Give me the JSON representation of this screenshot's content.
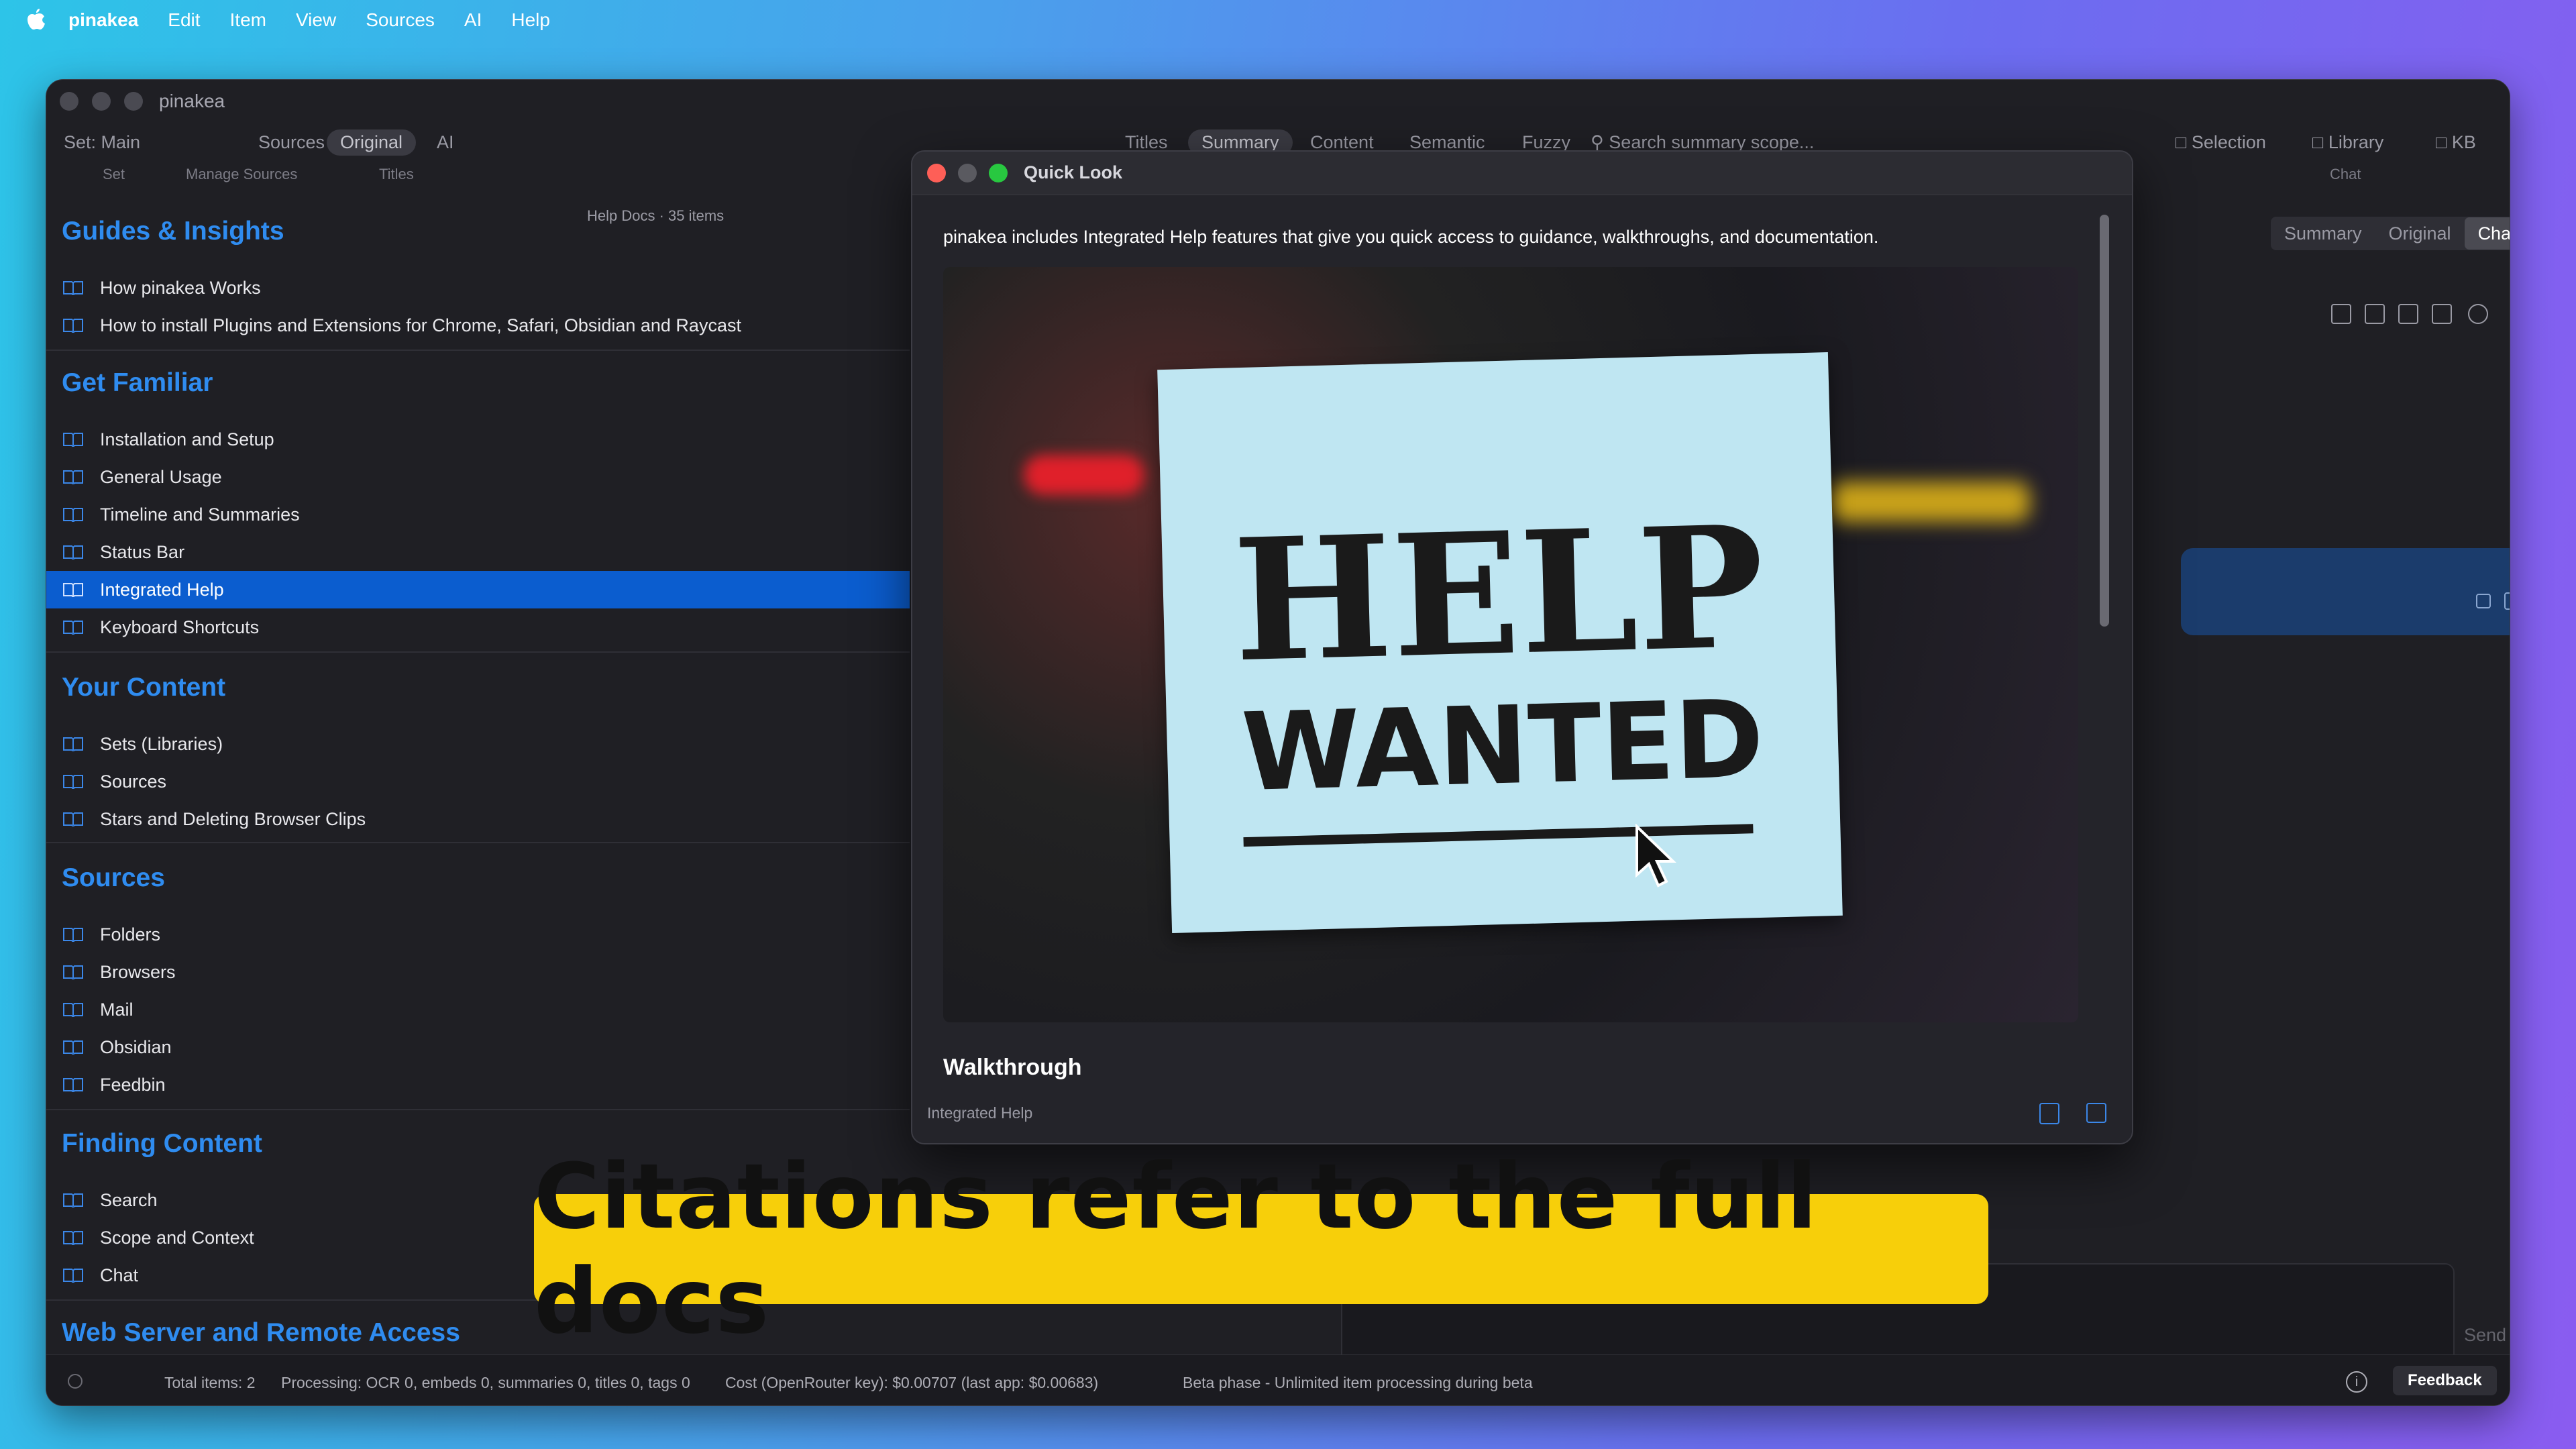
{
  "menubar": {
    "app": "pinakea",
    "items": [
      "Edit",
      "Item",
      "View",
      "Sources",
      "AI",
      "Help"
    ]
  },
  "window": {
    "title": "pinakea"
  },
  "toolbar": {
    "set": "Set: Main",
    "set_sub": "Set",
    "sources": "Sources",
    "sources_sub": "Manage Sources",
    "original": "Original",
    "ai": "AI",
    "titles_sub": "Titles",
    "tabs": [
      "Titles",
      "Summary",
      "Content",
      "Semantic",
      "Fuzzy"
    ],
    "search_placeholder": "Search summary scope...",
    "selection": "Selection",
    "library": "Library",
    "kb": "KB",
    "chat_sub": "Chat"
  },
  "sidebar": {
    "helpdocs": "Help Docs · 35 items",
    "sections": [
      {
        "title": "Guides & Insights",
        "items": [
          "How pinakea Works",
          "How to install Plugins and Extensions for Chrome, Safari, Obsidian and Raycast"
        ]
      },
      {
        "title": "Get Familiar",
        "items": [
          "Installation and Setup",
          "General Usage",
          "Timeline and Summaries",
          "Status Bar",
          "Integrated Help",
          "Keyboard Shortcuts"
        ]
      },
      {
        "title": "Your Content",
        "items": [
          "Sets (Libraries)",
          "Sources",
          "Stars and Deleting Browser Clips"
        ]
      },
      {
        "title": "Sources",
        "items": [
          "Folders",
          "Browsers",
          "Mail",
          "Obsidian",
          "Feedbin"
        ]
      },
      {
        "title": "Finding Content",
        "items": [
          "Search",
          "Scope and Context",
          "Chat"
        ]
      },
      {
        "title": "Web Server and Remote Access",
        "items": []
      }
    ],
    "selected": "Integrated Help"
  },
  "right": {
    "segments": [
      "Summary",
      "Original",
      "Chat"
    ],
    "active": "Chat"
  },
  "quicklook": {
    "title": "Quick Look",
    "intro": "pinakea includes Integrated Help features that give you quick access to guidance, walkthroughs, and documentation.",
    "image_line1": "HELP",
    "image_line2": "WANTED",
    "heading": "Walkthrough",
    "footer": "Integrated Help"
  },
  "composer": {
    "send": "Send"
  },
  "caption": "Citations refer to the full docs",
  "status": {
    "total": "Total items: 2",
    "processing": "Processing: OCR 0, embeds 0, summaries 0, titles 0, tags 0",
    "cost": "Cost (OpenRouter key): $0.00707 (last app: $0.00683)",
    "beta": "Beta phase - Unlimited item processing during beta",
    "feedback": "Feedback"
  },
  "colors": {
    "accent": "#2f8cf0",
    "selection": "#0b5dcf",
    "caption_bg": "#f7cf0a"
  }
}
